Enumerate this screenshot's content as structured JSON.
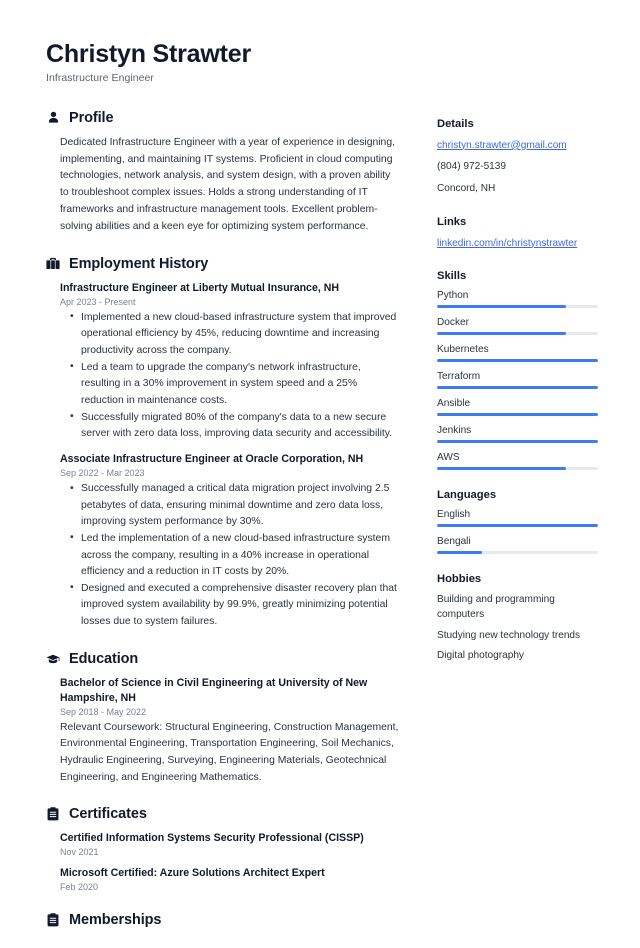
{
  "header": {
    "name": "Christyn Strawter",
    "job_title": "Infrastructure Engineer"
  },
  "theme": {
    "accent": "#3f7cf0",
    "link": "#3f68e0",
    "heading": "#12192b",
    "body_text": "#2b3240",
    "muted": "#7b8291",
    "track": "#e7e9ec",
    "background": "#ffffff"
  },
  "main": {
    "profile": {
      "icon": "person-icon",
      "title": "Profile",
      "text": "Dedicated Infrastructure Engineer with a year of experience in designing, implementing, and maintaining IT systems. Proficient in cloud computing technologies, network analysis, and system design, with a proven ability to troubleshoot complex issues. Holds a strong understanding of IT frameworks and infrastructure management tools. Excellent problem-solving abilities and a keen eye for optimizing system performance."
    },
    "employment": {
      "icon": "briefcase-icon",
      "title": "Employment History",
      "entries": [
        {
          "title": "Infrastructure Engineer at Liberty Mutual Insurance, NH",
          "date": "Apr 2023 - Present",
          "bullets": [
            "Implemented a new cloud-based infrastructure system that improved operational efficiency by 45%, reducing downtime and increasing productivity across the company.",
            "Led a team to upgrade the company's network infrastructure, resulting in a 30% improvement in system speed and a 25% reduction in maintenance costs.",
            "Successfully migrated 80% of the company's data to a new secure server with zero data loss, improving data security and accessibility."
          ]
        },
        {
          "title": "Associate Infrastructure Engineer at Oracle Corporation, NH",
          "date": "Sep 2022 - Mar 2023",
          "bullets": [
            "Successfully managed a critical data migration project involving 2.5 petabytes of data, ensuring minimal downtime and zero data loss, improving system performance by 30%.",
            "Led the implementation of a new cloud-based infrastructure system across the company, resulting in a 40% increase in operational efficiency and a reduction in IT costs by 20%.",
            "Designed and executed a comprehensive disaster recovery plan that improved system availability by 99.9%, greatly minimizing potential losses due to system failures."
          ]
        }
      ]
    },
    "education": {
      "icon": "graduation-cap-icon",
      "title": "Education",
      "entries": [
        {
          "title": "Bachelor of Science in Civil Engineering at University of New Hampshire, NH",
          "date": "Sep 2018 - May 2022",
          "description": "Relevant Coursework: Structural Engineering, Construction Management, Environmental Engineering, Transportation Engineering, Soil Mechanics, Hydraulic Engineering, Surveying, Engineering Materials, Geotechnical Engineering, and Engineering Mathematics."
        }
      ]
    },
    "certificates": {
      "icon": "clipboard-icon",
      "title": "Certificates",
      "entries": [
        {
          "title": "Certified Information Systems Security Professional (CISSP)",
          "date": "Nov 2021"
        },
        {
          "title": "Microsoft Certified: Azure Solutions Architect Expert",
          "date": "Feb 2020"
        }
      ]
    },
    "memberships": {
      "icon": "clipboard-icon",
      "title": "Memberships"
    }
  },
  "sidebar": {
    "details": {
      "title": "Details",
      "email": "christyn.strawter@gmail.com",
      "phone": "(804) 972-5139",
      "location": "Concord, NH"
    },
    "links": {
      "title": "Links",
      "items": [
        {
          "label": "linkedin.com/in/christynstrawter"
        }
      ]
    },
    "skills": {
      "title": "Skills",
      "items": [
        {
          "label": "Python",
          "level": 80
        },
        {
          "label": "Docker",
          "level": 80
        },
        {
          "label": "Kubernetes",
          "level": 100
        },
        {
          "label": "Terraform",
          "level": 100
        },
        {
          "label": "Ansible",
          "level": 100
        },
        {
          "label": "Jenkins",
          "level": 100
        },
        {
          "label": "AWS",
          "level": 80
        }
      ]
    },
    "languages": {
      "title": "Languages",
      "items": [
        {
          "label": "English",
          "level": 100
        },
        {
          "label": "Bengali",
          "level": 28
        }
      ]
    },
    "hobbies": {
      "title": "Hobbies",
      "items": [
        {
          "label": "Building and programming computers"
        },
        {
          "label": "Studying new technology trends"
        },
        {
          "label": "Digital photography"
        }
      ]
    }
  }
}
